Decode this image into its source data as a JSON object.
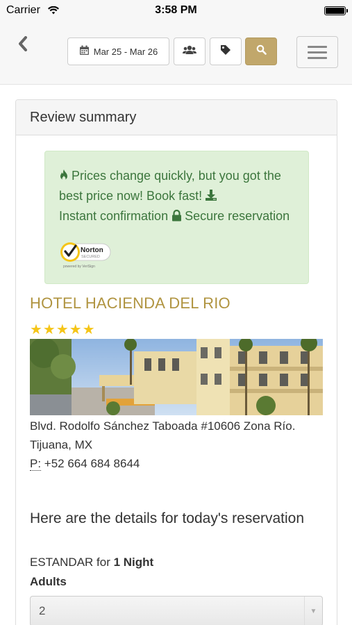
{
  "status_bar": {
    "carrier": "Carrier",
    "time": "3:58 PM"
  },
  "nav": {
    "back_icon": "chevron-left-icon",
    "date_range": "Mar 25 - Mar 26",
    "date_icon": "calendar-icon",
    "guests_icon": "users-icon",
    "tag_icon": "tag-icon",
    "search_icon": "search-icon",
    "menu_icon": "hamburger-icon"
  },
  "colors": {
    "accent_gold": "#c1a76b",
    "hotel_name": "#b09440",
    "alert_bg": "#dff0d8",
    "alert_text": "#3c763d",
    "stars": "#f5c518"
  },
  "panel": {
    "heading": "Review summary",
    "alert": {
      "line1": "Prices change quickly, but you got the best price now! Book fast!",
      "line2": "Instant confirmation",
      "line3": "Secure reservation",
      "norton_brand": "Norton",
      "norton_secured": "SECURED",
      "norton_powered": "powered by VeriSign"
    },
    "hotel": {
      "name": "HOTEL HACIENDA DEL RIO",
      "stars": 5,
      "stars_text": "★★★★★",
      "address_line": "Blvd. Rodolfo Sánchez Taboada #10606 Zona Río.",
      "city": "Tijuana, MX",
      "phone_label": "P:",
      "phone": "+52 664 684 8644"
    },
    "details": {
      "title": "Here are the details for today's reservation",
      "room_type": "ESTANDAR for ",
      "nights": "1 Night",
      "adults_label": "Adults",
      "adults_value": "2"
    }
  }
}
